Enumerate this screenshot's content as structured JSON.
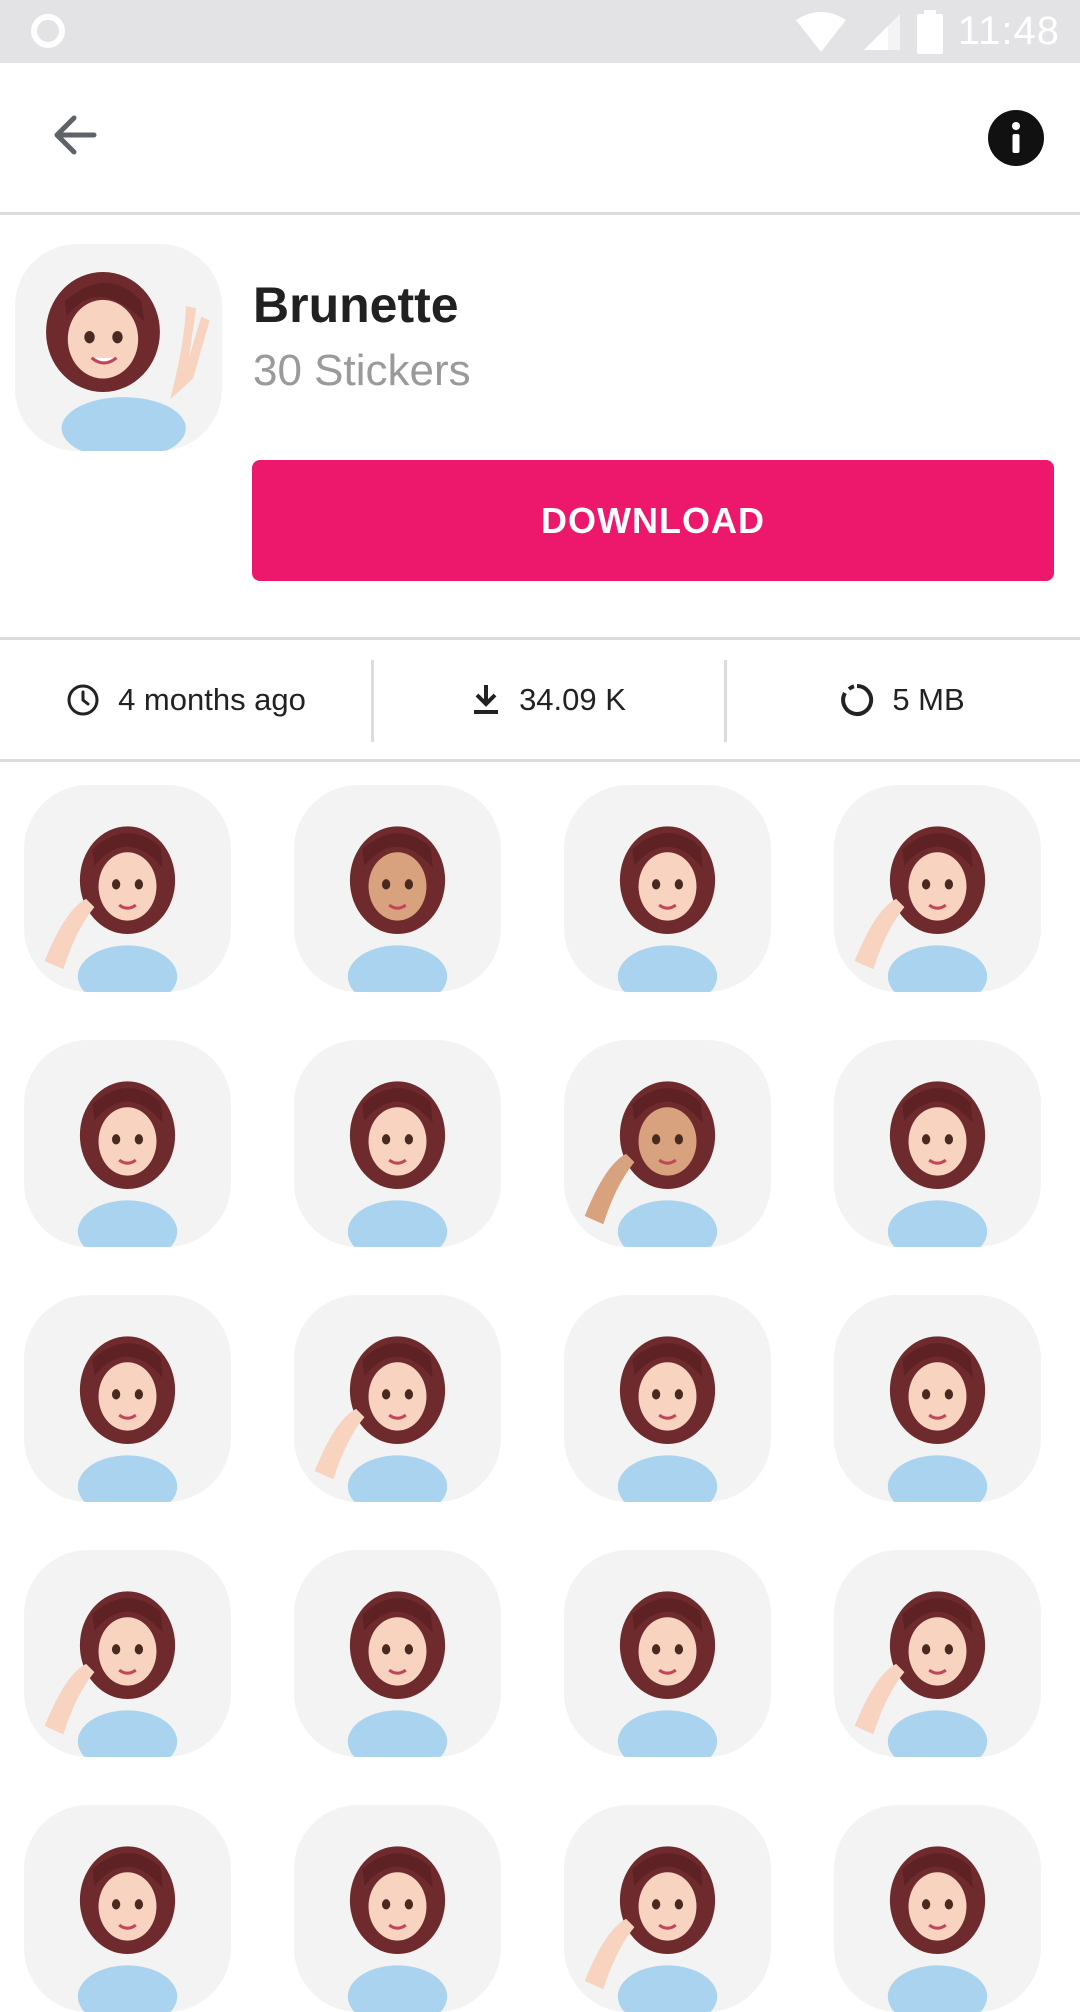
{
  "status_bar": {
    "time": "11:48"
  },
  "app_bar": {
    "back_icon": "arrow-left-icon",
    "info_icon": "info-icon"
  },
  "pack": {
    "title": "Brunette",
    "count_label": "30 Stickers",
    "download_label": "DOWNLOAD"
  },
  "stats": {
    "updated": "4 months ago",
    "downloads": "34.09 K",
    "size": "5 MB"
  },
  "colors": {
    "accent": "#ed176b",
    "tile_bg": "#f3f3f3",
    "status_bar": "#e3e3e6"
  },
  "stickers": [
    {
      "name": "sticker-peace-sign"
    },
    {
      "name": "sticker-thumbs-up"
    },
    {
      "name": "sticker-wave"
    },
    {
      "name": "sticker-cheeks"
    },
    {
      "name": "sticker-hand-on-head"
    },
    {
      "name": "sticker-hands-together"
    },
    {
      "name": "sticker-chin-rest"
    },
    {
      "name": "sticker-chin-hands"
    },
    {
      "name": "sticker-pointing"
    },
    {
      "name": "sticker-hat"
    },
    {
      "name": "sticker-thinking"
    },
    {
      "name": "sticker-smile"
    },
    {
      "name": "sticker-sad"
    },
    {
      "name": "sticker-worried"
    },
    {
      "name": "sticker-touch-face"
    },
    {
      "name": "sticker-looking-up"
    },
    {
      "name": "sticker-pointing-left"
    },
    {
      "name": "sticker-covering-ears"
    },
    {
      "name": "sticker-neutral"
    },
    {
      "name": "sticker-frown"
    }
  ]
}
